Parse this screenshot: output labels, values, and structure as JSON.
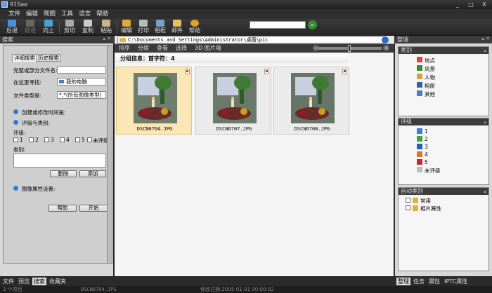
{
  "window": {
    "title": "91See",
    "min": "_",
    "max": "□",
    "close": "X"
  },
  "menu": [
    "文件",
    "编辑",
    "视图",
    "工具",
    "语言",
    "帮助"
  ],
  "toolbar": {
    "back": "后退",
    "forward": "前进",
    "up": "向上",
    "cut": "剪切",
    "copy": "复制",
    "paste": "粘贴",
    "edit": "编辑",
    "print": "打印",
    "frame": "相框",
    "mail": "邮件",
    "help": "帮助",
    "search_placeholder": ""
  },
  "left_panel": {
    "title": "搜索",
    "tabs": [
      "详细搜索",
      "历史搜索"
    ],
    "filename_label": "完整或部分文件名:",
    "filename_value": "",
    "search_in_label": "在这里寻找:",
    "search_in_value": "我的电脑",
    "filetype_label": "文件类型是:",
    "filetype_value": "*.*(所有图像类型)",
    "section_date": "创建或修改时间是:",
    "section_rating": "评级与类别:",
    "rating_label": "评级:",
    "ratings": [
      "1",
      "2",
      "3",
      "4",
      "5",
      "未评级"
    ],
    "category_label": "类别:",
    "delete_btn": "删除",
    "add_btn": "添加",
    "section_props": "图像属性设置:",
    "help_btn": "帮助",
    "start_btn": "开始",
    "bottom_tabs": [
      "文件",
      "预览",
      "搜索",
      "收藏夹"
    ],
    "active_bottom_tab": "搜索"
  },
  "center": {
    "address": "C:\\Documents and Settings\\Administrator\\桌面\\pic",
    "view_items": [
      "排序",
      "分组",
      "查看",
      "选择",
      "3D 图片墙"
    ],
    "group_header": "分组信息：首字符：4",
    "thumbnails": [
      {
        "name": "DSCN6704.JPG",
        "selected": true
      },
      {
        "name": "DSCN6707.JPG",
        "selected": false
      },
      {
        "name": "DSCN6708.JPG",
        "selected": false
      }
    ]
  },
  "right_panel": {
    "title": "整理",
    "categories_title": "类别",
    "categories": [
      "地点",
      "风景",
      "人物",
      "相册",
      "其他"
    ],
    "rating_title": "评级",
    "rating_items": [
      "1",
      "2",
      "3",
      "4",
      "5",
      "未评级"
    ],
    "auto_title": "自动类别",
    "auto_items": [
      "常用",
      "相片属性"
    ],
    "bottom_tabs": [
      "整理",
      "任务",
      "属性",
      "IPTC属性"
    ],
    "active_bottom_tab": "整理",
    "colors": {
      "r1": "#3a7fd5",
      "r2": "#4aa03a",
      "r3": "#2a5fc0",
      "r4": "#e0732a",
      "r5": "#c8282a",
      "r0": "#bdbdbd"
    }
  },
  "status": {
    "count": "3 个项目",
    "file": "DSCN6704.JPG",
    "date": "修改日期:2005-01-01 00:00:02"
  }
}
